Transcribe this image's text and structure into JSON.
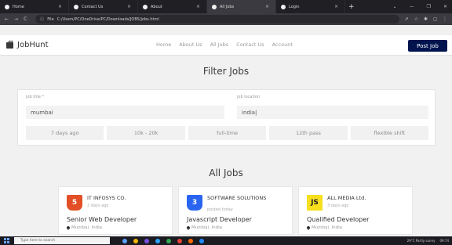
{
  "browser": {
    "tabs": [
      {
        "label": "Home",
        "active": false
      },
      {
        "label": "Contact Us",
        "active": false
      },
      {
        "label": "About",
        "active": false
      },
      {
        "label": "All Jobs",
        "active": true
      },
      {
        "label": "Login",
        "active": false
      }
    ],
    "tab_close_glyph": "×",
    "new_tab_glyph": "+",
    "window_controls": [
      "⌄",
      "—",
      "❐",
      "✕"
    ],
    "address": {
      "scheme_label": "File",
      "url": "C:/Users/PC/OneDrive/PC/Downloads/JOBS/jobs.html"
    },
    "nav_glyphs": {
      "back": "←",
      "forward": "→",
      "reload": "C",
      "info": "ⓘ"
    },
    "right_icons": [
      "⇗",
      "☆",
      "✱",
      "◻",
      "⋮"
    ]
  },
  "site": {
    "brand": "JobHunt",
    "nav": [
      "Home",
      "About Us",
      "All Jobs",
      "Contact Us",
      "Account"
    ],
    "post_job_label": "Post Job"
  },
  "filter": {
    "title": "Filter Jobs",
    "job_title_label": "job title *",
    "job_title_value": "mumbai",
    "job_location_label": "job location",
    "job_location_value": "india|",
    "chips": [
      "7 days ago",
      "10k - 20k",
      "full-time",
      "12th pass",
      "flexible shift"
    ]
  },
  "jobs": {
    "title": "All Jobs",
    "cards": [
      {
        "logo": "5",
        "logo_icon": "html5-icon",
        "company": "IT INFOSYS CO.",
        "posted": "2 days ago",
        "title": "Senior Web Developer",
        "location": "Mumbai, India"
      },
      {
        "logo": "3",
        "logo_icon": "css3-icon",
        "company": "SOFTWARE SOLUTIONS",
        "posted": "posted today",
        "title": "Javascript Developer",
        "location": "Mumbai, India"
      },
      {
        "logo": "JS",
        "logo_icon": "javascript-icon",
        "company": "ALL MEDIA Ltd.",
        "posted": "3 days ago",
        "title": "Qualified Developer",
        "location": "Mumbai, India"
      }
    ]
  },
  "taskbar": {
    "search_placeholder": "Type here to search",
    "tray_text": "29°C  Partly sunny",
    "time": "09:74"
  },
  "colors": {
    "post_button": "#00134f",
    "browser_dark": "#1f1f24",
    "html5": "#e34f26",
    "css3": "#2965f1",
    "js": "#f7df1e"
  }
}
